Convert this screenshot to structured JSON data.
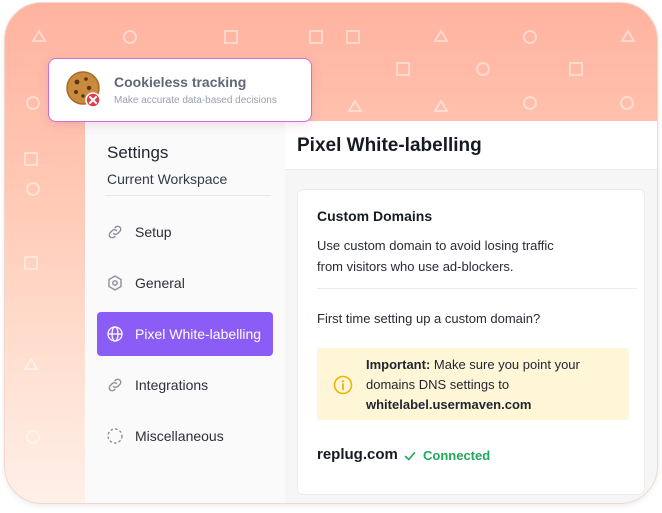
{
  "colors": {
    "accent": "#8b5cf6",
    "success": "#22a85a",
    "warning_bg": "#fef6d6",
    "warning_icon": "#f0b400",
    "toast_border": "#d26bd2"
  },
  "toast": {
    "icon": "cookie-blocked-icon",
    "title": "Cookieless tracking",
    "subtitle": "Make accurate data-based decisions"
  },
  "sidebar": {
    "title": "Settings",
    "workspace": "Current Workspace",
    "items": [
      {
        "label": "Setup",
        "icon": "link-icon",
        "active": false
      },
      {
        "label": "General",
        "icon": "hexagon-gear-icon",
        "active": false
      },
      {
        "label": "Pixel White-labelling",
        "icon": "globe-icon",
        "active": true
      },
      {
        "label": "Integrations",
        "icon": "link-icon",
        "active": false
      },
      {
        "label": "Miscellaneous",
        "icon": "dashed-circle-icon",
        "active": false
      }
    ]
  },
  "main": {
    "page_title": "Pixel White-labelling",
    "card": {
      "title": "Custom Domains",
      "description": "Use custom domain to avoid losing traffic from visitors who use ad-blockers.",
      "first_time": "First time setting up a custom domain?",
      "important_label": "Important:",
      "important_text": " Make sure you point your domains DNS settings to ",
      "important_domain": "whitelabel.usermaven.com",
      "domain": "replug.com",
      "status": "Connected"
    }
  }
}
